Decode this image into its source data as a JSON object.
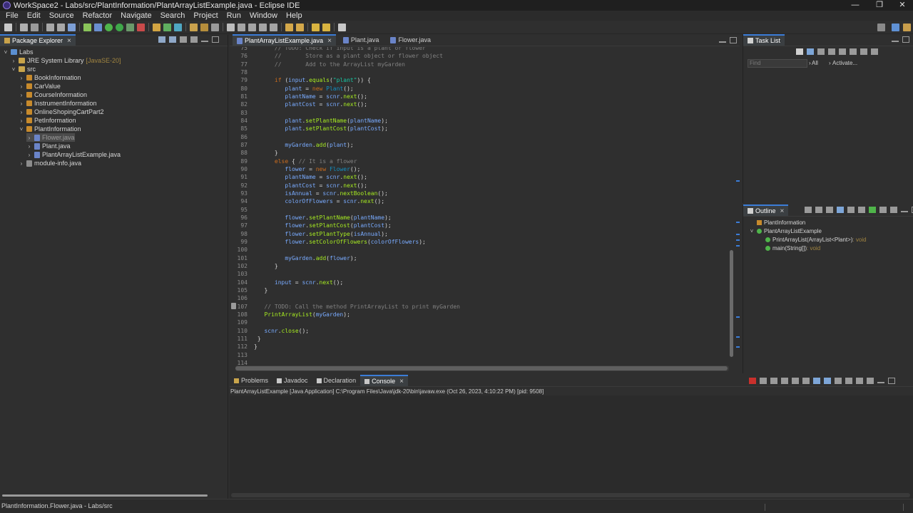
{
  "window": {
    "title": "WorkSpace2 - Labs/src/PlantInformation/PlantArrayListExample.java - Eclipse IDE",
    "controls": [
      "—",
      "❐",
      "✕"
    ]
  },
  "menu": [
    "File",
    "Edit",
    "Source",
    "Refactor",
    "Navigate",
    "Search",
    "Project",
    "Run",
    "Window",
    "Help"
  ],
  "package_explorer": {
    "tab_label": "Package Explorer",
    "tree": [
      {
        "label": "Labs",
        "icon": "project-icon",
        "twisty": "v",
        "indent": 0
      },
      {
        "label": "JRE System Library",
        "suffix": "[JavaSE-20]",
        "icon": "library-icon",
        "twisty": ">",
        "indent": 1
      },
      {
        "label": "src",
        "icon": "source-folder-icon",
        "twisty": "v",
        "indent": 1
      },
      {
        "label": "BookInformation",
        "icon": "package-icon",
        "twisty": ">",
        "indent": 2
      },
      {
        "label": "CarValue",
        "icon": "package-icon",
        "twisty": ">",
        "indent": 2
      },
      {
        "label": "CourseInformation",
        "icon": "package-icon",
        "twisty": ">",
        "indent": 2
      },
      {
        "label": "InstrumentInformation",
        "icon": "package-icon",
        "twisty": ">",
        "indent": 2
      },
      {
        "label": "OnlineShopingCartPart2",
        "icon": "package-icon",
        "twisty": ">",
        "indent": 2
      },
      {
        "label": "PetInformation",
        "icon": "package-icon",
        "twisty": ">",
        "indent": 2
      },
      {
        "label": "PlantInformation",
        "icon": "package-icon",
        "twisty": "v",
        "indent": 2
      },
      {
        "label": "Flower.java",
        "icon": "java-file-icon",
        "twisty": ">",
        "indent": 3,
        "selected": true
      },
      {
        "label": "Plant.java",
        "icon": "java-file-icon",
        "twisty": ">",
        "indent": 3
      },
      {
        "label": "PlantArrayListExample.java",
        "icon": "java-file-icon",
        "twisty": ">",
        "indent": 3
      },
      {
        "label": "module-info.java",
        "icon": "module-file-icon",
        "twisty": ">",
        "indent": 2
      }
    ]
  },
  "editor": {
    "tabs": [
      {
        "label": "PlantArrayListExample.java",
        "active": true
      },
      {
        "label": "Plant.java",
        "active": false
      },
      {
        "label": "Flower.java",
        "active": false
      }
    ],
    "lines": [
      {
        "n": "75",
        "code": [
          [
            "cm",
            "      // TODO: Check if input is a plant or flower"
          ]
        ]
      },
      {
        "n": "76",
        "code": [
          [
            "cm",
            "      //       Store as a plant object or flower object"
          ]
        ]
      },
      {
        "n": "77",
        "code": [
          [
            "cm",
            "      //       Add to the ArrayList myGarden"
          ]
        ]
      },
      {
        "n": "78",
        "code": []
      },
      {
        "n": "79",
        "code": [
          [
            "kw",
            "      if"
          ],
          [
            "",
            " ("
          ],
          [
            "vr",
            "input"
          ],
          [
            "",
            "."
          ],
          [
            "mt",
            "equals"
          ],
          [
            "",
            "("
          ],
          [
            "st",
            "\"plant\""
          ],
          [
            "",
            ")) {"
          ]
        ]
      },
      {
        "n": "80",
        "code": [
          [
            "vr",
            "         plant"
          ],
          [
            "",
            " = "
          ],
          [
            "kw",
            "new"
          ],
          [
            "",
            " "
          ],
          [
            "tp",
            "Plant"
          ],
          [
            "",
            "();"
          ]
        ]
      },
      {
        "n": "81",
        "code": [
          [
            "vr",
            "         plantName"
          ],
          [
            "",
            " = "
          ],
          [
            "vr",
            "scnr"
          ],
          [
            "",
            "."
          ],
          [
            "mt",
            "next"
          ],
          [
            "",
            "();"
          ]
        ]
      },
      {
        "n": "82",
        "code": [
          [
            "vr",
            "         plantCost"
          ],
          [
            "",
            " = "
          ],
          [
            "vr",
            "scnr"
          ],
          [
            "",
            "."
          ],
          [
            "mt",
            "next"
          ],
          [
            "",
            "();"
          ]
        ]
      },
      {
        "n": "83",
        "code": []
      },
      {
        "n": "84",
        "code": [
          [
            "vr",
            "         plant"
          ],
          [
            "",
            "."
          ],
          [
            "mt",
            "setPlantName"
          ],
          [
            "",
            "("
          ],
          [
            "vr",
            "plantName"
          ],
          [
            "",
            ");"
          ]
        ]
      },
      {
        "n": "85",
        "code": [
          [
            "vr",
            "         plant"
          ],
          [
            "",
            "."
          ],
          [
            "mt",
            "setPlantCost"
          ],
          [
            "",
            "("
          ],
          [
            "vr",
            "plantCost"
          ],
          [
            "",
            ");"
          ]
        ]
      },
      {
        "n": "86",
        "code": []
      },
      {
        "n": "87",
        "code": [
          [
            "vr",
            "         myGarden"
          ],
          [
            "",
            "."
          ],
          [
            "mt",
            "add"
          ],
          [
            "",
            "("
          ],
          [
            "vr",
            "plant"
          ],
          [
            "",
            ");"
          ]
        ]
      },
      {
        "n": "88",
        "code": [
          [
            "",
            "      }"
          ]
        ]
      },
      {
        "n": "89",
        "code": [
          [
            "kw",
            "      else"
          ],
          [
            "",
            " { "
          ],
          [
            "cm",
            "// It is a flower"
          ]
        ]
      },
      {
        "n": "90",
        "code": [
          [
            "vr",
            "         flower"
          ],
          [
            "",
            " = "
          ],
          [
            "kw",
            "new"
          ],
          [
            "",
            " "
          ],
          [
            "tp",
            "Flower"
          ],
          [
            "",
            "();"
          ]
        ]
      },
      {
        "n": "91",
        "code": [
          [
            "vr",
            "         plantName"
          ],
          [
            "",
            " = "
          ],
          [
            "vr",
            "scnr"
          ],
          [
            "",
            "."
          ],
          [
            "mt",
            "next"
          ],
          [
            "",
            "();"
          ]
        ]
      },
      {
        "n": "92",
        "code": [
          [
            "vr",
            "         plantCost"
          ],
          [
            "",
            " = "
          ],
          [
            "vr",
            "scnr"
          ],
          [
            "",
            "."
          ],
          [
            "mt",
            "next"
          ],
          [
            "",
            "();"
          ]
        ]
      },
      {
        "n": "93",
        "code": [
          [
            "vr",
            "         isAnnual"
          ],
          [
            "",
            " = "
          ],
          [
            "vr",
            "scnr"
          ],
          [
            "",
            "."
          ],
          [
            "mt",
            "nextBoolean"
          ],
          [
            "",
            "();"
          ]
        ]
      },
      {
        "n": "94",
        "code": [
          [
            "vr",
            "         colorOfFlowers"
          ],
          [
            "",
            " = "
          ],
          [
            "vr",
            "scnr"
          ],
          [
            "",
            "."
          ],
          [
            "mt",
            "next"
          ],
          [
            "",
            "();"
          ]
        ]
      },
      {
        "n": "95",
        "code": []
      },
      {
        "n": "96",
        "code": [
          [
            "vr",
            "         flower"
          ],
          [
            "",
            "."
          ],
          [
            "mt",
            "setPlantName"
          ],
          [
            "",
            "("
          ],
          [
            "vr",
            "plantName"
          ],
          [
            "",
            ");"
          ]
        ]
      },
      {
        "n": "97",
        "code": [
          [
            "vr",
            "         flower"
          ],
          [
            "",
            "."
          ],
          [
            "mt",
            "setPlantCost"
          ],
          [
            "",
            "("
          ],
          [
            "vr",
            "plantCost"
          ],
          [
            "",
            ");"
          ]
        ]
      },
      {
        "n": "98",
        "code": [
          [
            "vr",
            "         flower"
          ],
          [
            "",
            "."
          ],
          [
            "mt",
            "setPlantType"
          ],
          [
            "",
            "("
          ],
          [
            "vr",
            "isAnnual"
          ],
          [
            "",
            ");"
          ]
        ]
      },
      {
        "n": "99",
        "code": [
          [
            "vr",
            "         flower"
          ],
          [
            "",
            "."
          ],
          [
            "mt",
            "setColorOfFlowers"
          ],
          [
            "",
            "("
          ],
          [
            "vr",
            "colorOfFlowers"
          ],
          [
            "",
            ");"
          ]
        ]
      },
      {
        "n": "100",
        "code": []
      },
      {
        "n": "101",
        "code": [
          [
            "vr",
            "         myGarden"
          ],
          [
            "",
            "."
          ],
          [
            "mt",
            "add"
          ],
          [
            "",
            "("
          ],
          [
            "vr",
            "flower"
          ],
          [
            "",
            ");"
          ]
        ]
      },
      {
        "n": "102",
        "code": [
          [
            "",
            "      }"
          ]
        ]
      },
      {
        "n": "103",
        "code": []
      },
      {
        "n": "104",
        "code": [
          [
            "vr",
            "      input"
          ],
          [
            "",
            " = "
          ],
          [
            "vr",
            "scnr"
          ],
          [
            "",
            "."
          ],
          [
            "mt",
            "next"
          ],
          [
            "",
            "();"
          ]
        ]
      },
      {
        "n": "105",
        "code": [
          [
            "",
            "   }"
          ]
        ]
      },
      {
        "n": "106",
        "code": []
      },
      {
        "n": "107",
        "code": [
          [
            "cm",
            "   // TODO: Call the method PrintArrayList to print myGarden"
          ]
        ]
      },
      {
        "n": "108",
        "code": [
          [
            "mt",
            "   PrintArrayList"
          ],
          [
            "",
            "("
          ],
          [
            "vr",
            "myGarden"
          ],
          [
            "",
            ");"
          ]
        ]
      },
      {
        "n": "109",
        "code": []
      },
      {
        "n": "110",
        "code": [
          [
            "vr",
            "   scnr"
          ],
          [
            "",
            "."
          ],
          [
            "mt",
            "close"
          ],
          [
            "",
            "();"
          ]
        ]
      },
      {
        "n": "111",
        "code": [
          [
            "",
            " }"
          ]
        ]
      },
      {
        "n": "112",
        "code": [
          [
            "",
            "}"
          ]
        ]
      },
      {
        "n": "113",
        "code": []
      },
      {
        "n": "114",
        "code": []
      }
    ]
  },
  "task_list": {
    "tab_label": "Task List",
    "find_placeholder": "Find",
    "all_label": "All",
    "activate_label": "Activate..."
  },
  "outline": {
    "tab_label": "Outline",
    "items": [
      {
        "label": "PlantInformation",
        "detail": "",
        "indent": 0,
        "icon": "package-icon"
      },
      {
        "label": "PlantArrayListExample",
        "detail": "",
        "indent": 0,
        "icon": "class-icon",
        "twisty": "v"
      },
      {
        "label": "PrintArrayList(ArrayList<Plant>)",
        "detail": " : void",
        "indent": 1,
        "icon": "static-method-icon"
      },
      {
        "label": "main(String[])",
        "detail": " : void",
        "indent": 1,
        "icon": "static-method-icon"
      }
    ]
  },
  "console_area": {
    "tabs": [
      {
        "label": "Problems",
        "active": false,
        "icon": "problems-icon"
      },
      {
        "label": "Javadoc",
        "active": false,
        "icon": "javadoc-icon"
      },
      {
        "label": "Declaration",
        "active": false,
        "icon": "declaration-icon"
      },
      {
        "label": "Console",
        "active": true,
        "icon": "console-icon"
      }
    ],
    "description": "PlantArrayListExample [Java Application] C:\\Program Files\\Java\\jdk-20\\bin\\javaw.exe  (Oct 26, 2023, 4:10:22 PM) [pid: 9508]"
  },
  "status_bar": {
    "text": "PlantInformation.Flower.java - Labs/src"
  }
}
